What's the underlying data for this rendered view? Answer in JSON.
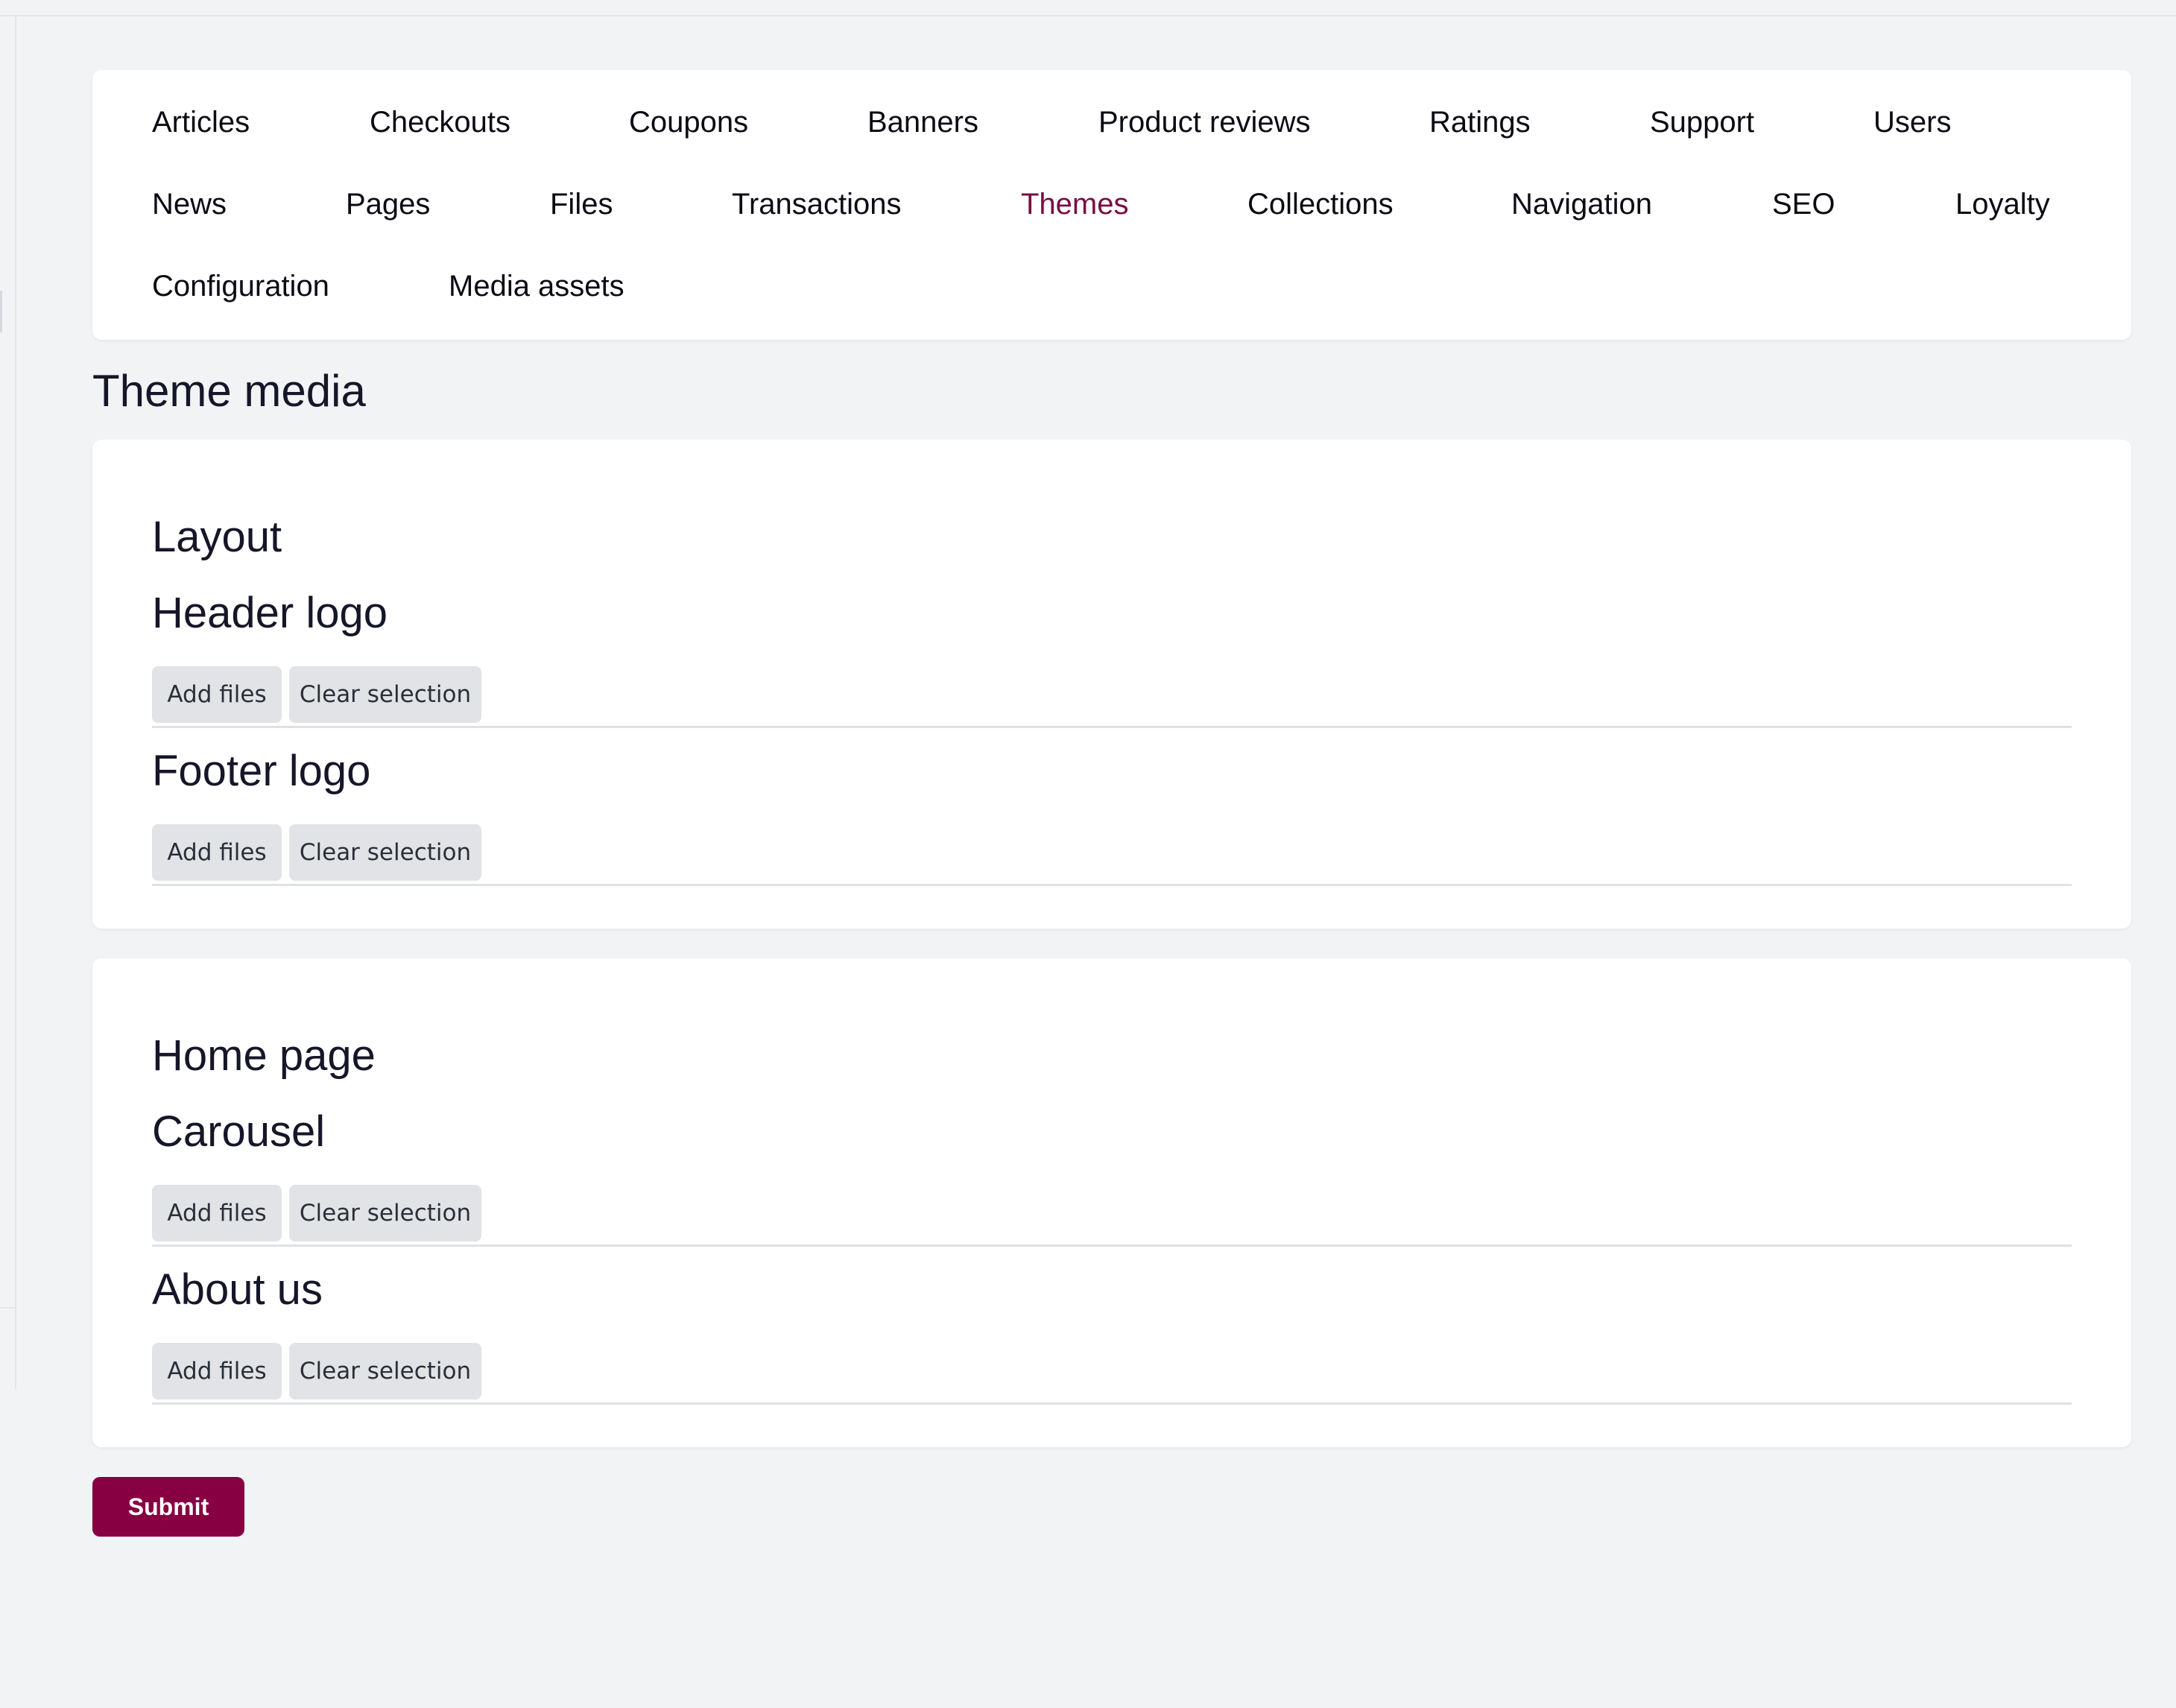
{
  "nav": {
    "items": [
      {
        "label": "Articles"
      },
      {
        "label": "Checkouts"
      },
      {
        "label": "Coupons"
      },
      {
        "label": "Banners"
      },
      {
        "label": "Product reviews"
      },
      {
        "label": "Ratings"
      },
      {
        "label": "Support"
      },
      {
        "label": "Users"
      },
      {
        "label": "News"
      },
      {
        "label": "Pages"
      },
      {
        "label": "Files"
      },
      {
        "label": "Transactions"
      },
      {
        "label": "Themes",
        "active": true
      },
      {
        "label": "Collections"
      },
      {
        "label": "Navigation"
      },
      {
        "label": "SEO"
      },
      {
        "label": "Loyalty"
      },
      {
        "label": "Configuration"
      },
      {
        "label": "Media assets"
      }
    ],
    "active_color": "#7a0c44"
  },
  "page": {
    "title": "Theme media"
  },
  "sections": [
    {
      "title": "Layout",
      "fields": [
        {
          "label": "Header logo",
          "add_label": "Add files",
          "clear_label": "Clear selection"
        },
        {
          "label": "Footer logo",
          "add_label": "Add files",
          "clear_label": "Clear selection"
        }
      ]
    },
    {
      "title": "Home page",
      "fields": [
        {
          "label": "Carousel",
          "add_label": "Add files",
          "clear_label": "Clear selection"
        },
        {
          "label": "About us",
          "add_label": "Add files",
          "clear_label": "Clear selection"
        }
      ]
    }
  ],
  "actions": {
    "submit_label": "Submit",
    "submit_color": "#870042"
  }
}
